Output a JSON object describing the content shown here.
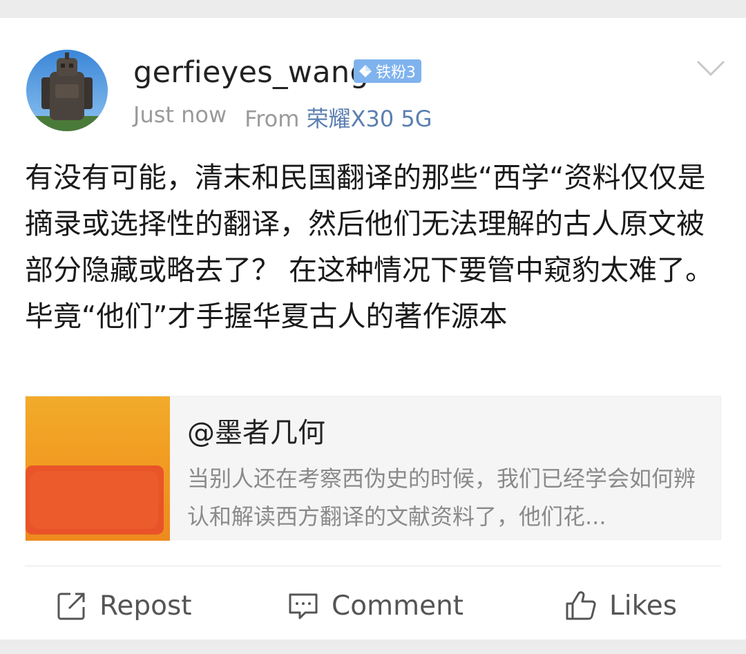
{
  "post": {
    "username": "gerfieyes_wang",
    "fan_badge": "铁粉3",
    "time": "Just now",
    "from_label": "From",
    "device": "荣耀X30 5G",
    "body": "有没有可能，清末和民国翻译的那些“西学“资料仅仅是摘录或选择性的翻译，然后他们无法理解的古人原文被部分隐藏或略去了？ 在这种情况下要管中窥豹太难了。毕竟“他们”才手握华夏古人的著作源本"
  },
  "quote": {
    "author": "@墨者几何",
    "snippet": "当别人还在考察西伪史的时候，我们已经学会如何辨认和解读西方翻译的文献资料了，他们花..."
  },
  "actions": {
    "repost": "Repost",
    "comment": "Comment",
    "likes": "Likes"
  },
  "colors": {
    "badge": "#7fb3ee",
    "device_link": "#5b7fb0",
    "thumb_orange": "#f0a020",
    "thumb_red": "#e8502a"
  },
  "icons": [
    "diamond-icon",
    "chevron-down-icon",
    "repost-icon",
    "comment-icon",
    "thumbs-up-icon"
  ]
}
